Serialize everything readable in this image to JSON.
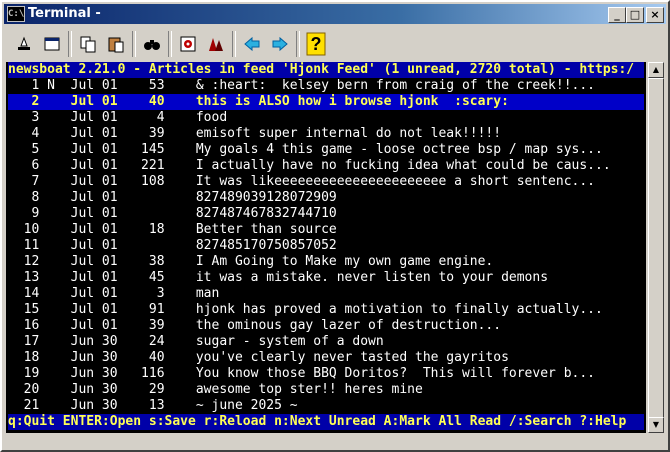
{
  "window": {
    "title": "Terminal -",
    "app_icon": "C:\\"
  },
  "titlebar_buttons": [
    "_",
    "□",
    "×"
  ],
  "toolbar": {
    "icons": [
      "mark-icon",
      "fullscreen-icon",
      "copy-icon",
      "paste-icon",
      "find-icon",
      "settings-icon",
      "font-icon",
      "scroll-left-icon",
      "scroll-right-icon",
      "help-icon"
    ]
  },
  "colors": {
    "terminal_bg": "#000000",
    "header_fg": "#ffff54",
    "header_bg": "#0000a8",
    "selected_bg": "#0000c8",
    "text": "#ffffff"
  },
  "newsboat": {
    "header": "newsboat 2.21.0 - Articles in feed 'Hjonk Feed' (1 unread, 2720 total) - https:/",
    "selected_index": 1,
    "articles": [
      "   1 N  Jul 01    53    & :heart:  kelsey bern from craig of the creek!!...",
      "   2    Jul 01    40    this is ALSO how i browse hjonk  :scary:",
      "   3    Jul 01     4    food",
      "   4    Jul 01    39    emisoft super internal do not leak!!!!!",
      "   5    Jul 01   145    My goals 4 this game - loose octree bsp / map sys...",
      "   6    Jul 01   221    I actually have no fucking idea what could be caus...",
      "   7    Jul 01   108    It was likeeeeeeeeeeeeeeeeeeeeee a short sentenc...",
      "   8    Jul 01          827489039128072909",
      "   9    Jul 01          827487467832744710",
      "  10    Jul 01    18    Better than source",
      "  11    Jul 01          827485170750857052",
      "  12    Jul 01    38    I Am Going to Make my own game engine.",
      "  13    Jul 01    45    it was a mistake. never listen to your demons",
      "  14    Jul 01     3    man",
      "  15    Jul 01    91    hjonk has proved a motivation to finally actually...",
      "  16    Jul 01    39    the ominous gay lazer of destruction...",
      "  17    Jun 30    24    sugar - system of a down",
      "  18    Jun 30    40    you've clearly never tasted the gayritos",
      "  19    Jun 30   116    You know those BBQ Doritos?  This will forever b...",
      "  20    Jun 30    29    awesome top ster!! heres mine",
      "  21    Jun 30    13    ~ june 2025 ~"
    ],
    "footer": "q:Quit ENTER:Open s:Save r:Reload n:Next Unread A:Mark All Read /:Search ?:Help"
  }
}
